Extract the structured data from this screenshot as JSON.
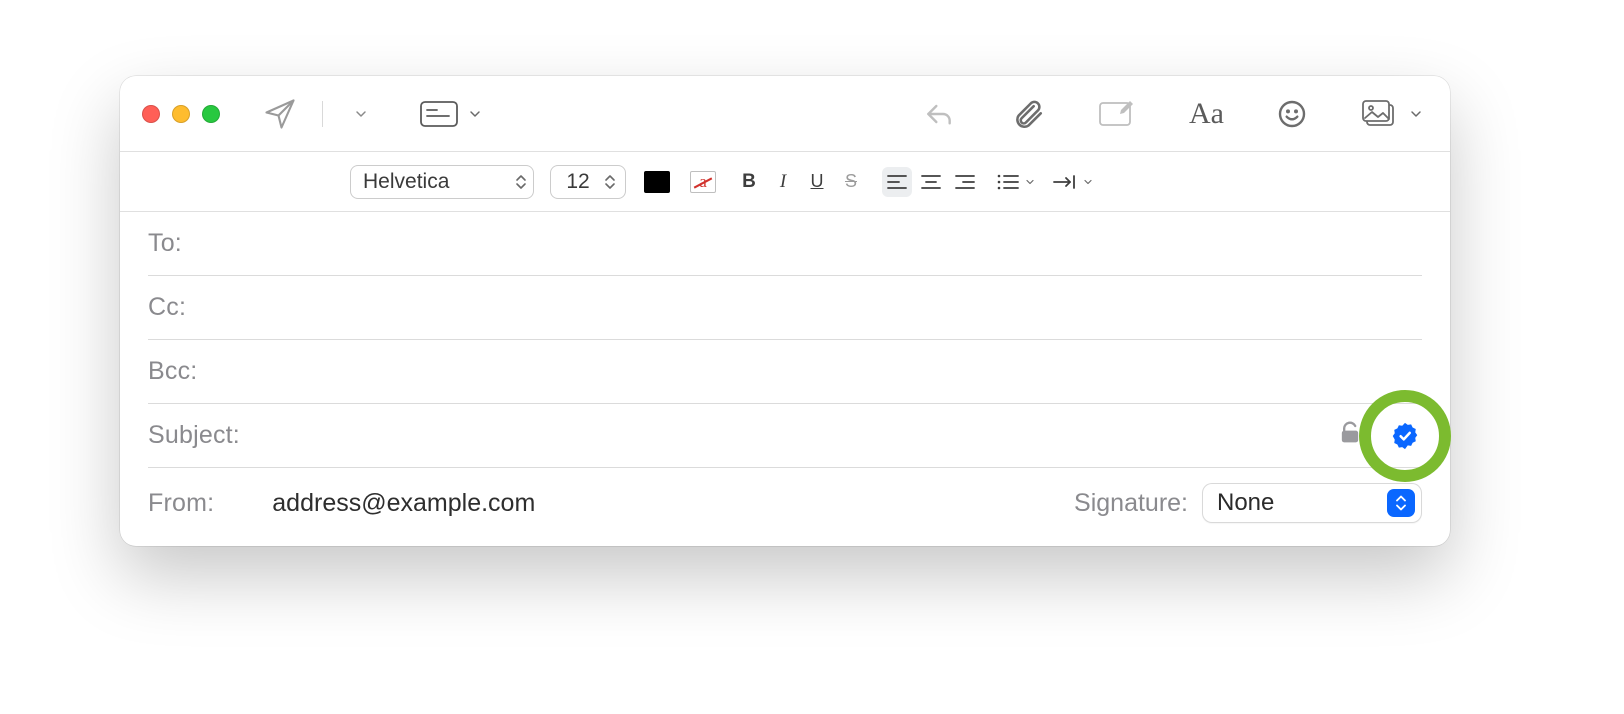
{
  "format": {
    "font": "Helvetica",
    "size": "12",
    "strike_sample": "a",
    "bold": "B",
    "italic": "I",
    "underline": "U",
    "strike": "S"
  },
  "fields": {
    "to_label": "To:",
    "cc_label": "Cc:",
    "bcc_label": "Bcc:",
    "subject_label": "Subject:",
    "from_label": "From:",
    "from_value": "address@example.com",
    "signature_label": "Signature:",
    "signature_value": "None"
  },
  "icons": {
    "send": "send-icon",
    "header_fields": "header-fields-icon",
    "reply": "reply-icon",
    "attach": "attach-icon",
    "markup": "markup-icon",
    "text_format": "text-format-icon",
    "emoji": "emoji-icon",
    "media": "media-icon",
    "lock": "unlock-icon",
    "signed": "signed-seal-icon"
  }
}
